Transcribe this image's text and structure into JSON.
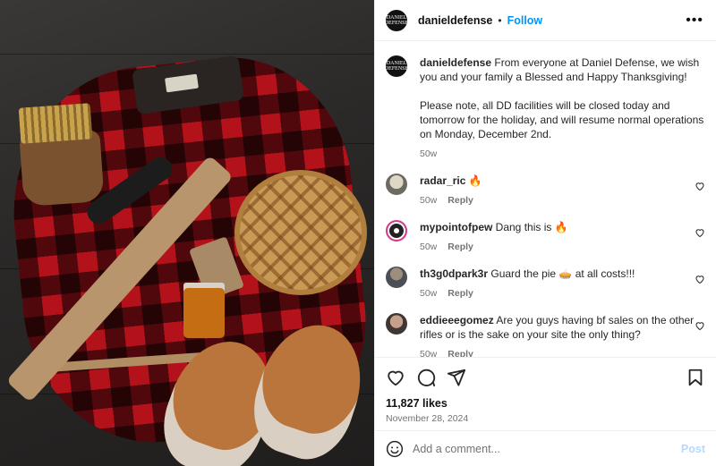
{
  "account": {
    "avatar_text": "DANIEL DEFENSE",
    "username": "danieldefense",
    "separator": "•",
    "follow_label": "Follow",
    "more_label": "•••"
  },
  "caption": {
    "username": "danieldefense",
    "text1": "From everyone at Daniel Defense, we wish you and your family a Blessed and Happy Thanksgiving!",
    "text2": "Please note, all DD facilities will be closed today and tomorrow for the holiday, and will resume normal operations on Monday, December 2nd.",
    "age": "50w"
  },
  "comments": [
    {
      "username": "radar_ric",
      "text": "🔥",
      "age": "50w",
      "reply_label": "Reply"
    },
    {
      "username": "mypointofpew",
      "text": "Dang this is 🔥",
      "age": "50w",
      "reply_label": "Reply"
    },
    {
      "username": "th3g0dpark3r",
      "text": "Guard the pie 🥧 at all costs!!!",
      "age": "50w",
      "reply_label": "Reply"
    },
    {
      "username": "eddieeegomez",
      "text": "Are you guys having bf sales on the other rifles or is the sake on your site the only thing?",
      "age": "50w",
      "reply_label": "Reply"
    }
  ],
  "stats": {
    "likes": "11,827 likes",
    "date": "November 28, 2024"
  },
  "composer": {
    "placeholder": "Add a comment...",
    "post_label": "Post"
  },
  "icons": {
    "like": "heart-icon",
    "comment": "comment-icon",
    "share": "share-icon",
    "save": "bookmark-icon",
    "emoji": "emoji-icon"
  },
  "colors": {
    "accent": "#0095f6",
    "post_disabled": "#b3dbff",
    "muted": "#737373"
  }
}
